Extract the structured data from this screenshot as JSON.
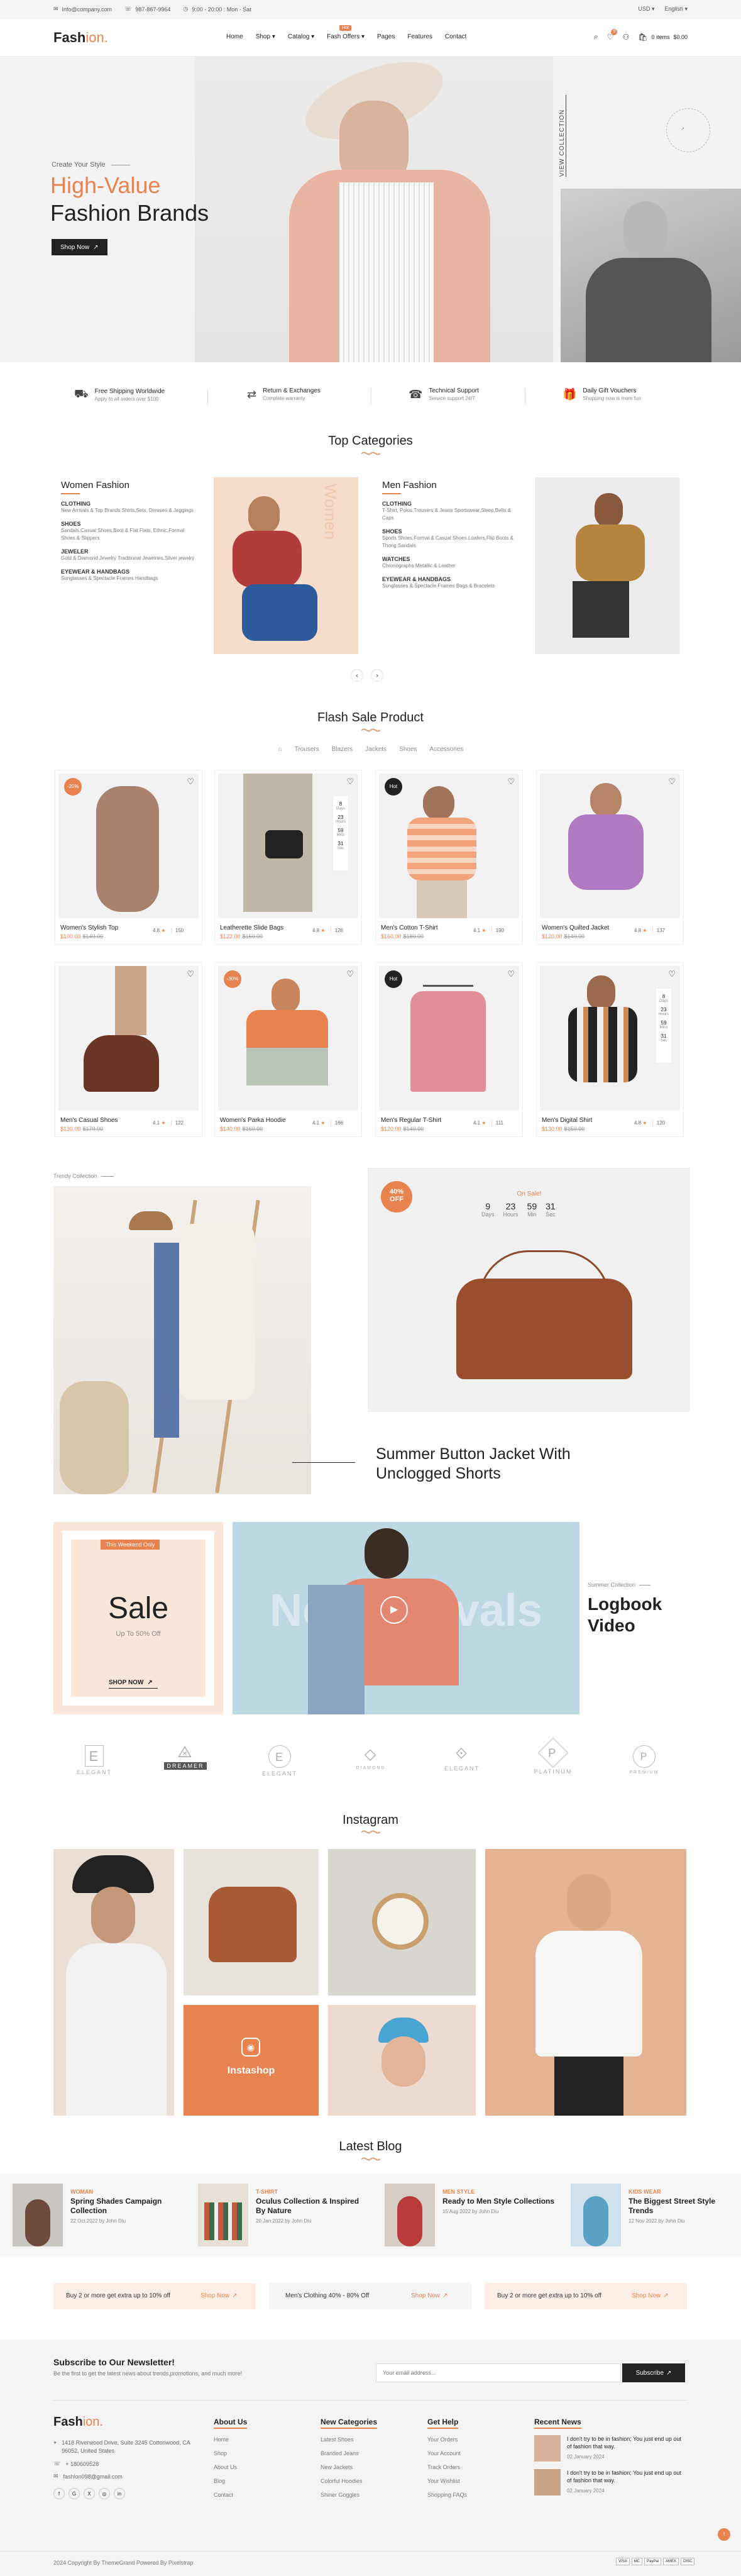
{
  "topbar": {
    "email": "Info@company.com",
    "phone": "987-867-9964",
    "hours": "9:00 - 20:00 : Mon - Sat",
    "currency": "USD",
    "language": "English"
  },
  "nav": {
    "logo_a": "Fash",
    "logo_b": "ion.",
    "menu": [
      "Home",
      "Shop",
      "Catalog",
      "Fash Offers",
      "Pages",
      "Features",
      "Contact"
    ],
    "hot_badge": "Hot",
    "cart_count": "0",
    "cart_label": "0 items",
    "cart_total": "$0.00",
    "wish_count": "0"
  },
  "hero": {
    "kicker": "Create Your Style",
    "title_a": "High-Value",
    "title_b": "Fashion Brands",
    "cta": "Shop Now",
    "side_link": "VIEW COLLECTION",
    "circle_text": "LUXURY · BEST SELLER · LUXURY ·"
  },
  "features": [
    {
      "title": "Free Shipping Worldwide",
      "sub": "Apply to all orders over $100"
    },
    {
      "title": "Return & Exchanges",
      "sub": "Complete warranty"
    },
    {
      "title": "Technical Support",
      "sub": "Service support 24/7"
    },
    {
      "title": "Daily Gift Vouchers",
      "sub": "Shopping now is more fun"
    }
  ],
  "categories": {
    "title": "Top Categories",
    "women": {
      "title": "Women Fashion",
      "groups": [
        {
          "h": "CLOTHING",
          "t": "New Arrivals & Top Brands Shirts,Sets, Dresses & Jeggings"
        },
        {
          "h": "SHOES",
          "t": "Sandals,Casual Shoes,Boot & Flat Flats, Ethnic,Formal Shoes & Slippers"
        },
        {
          "h": "JEWELER",
          "t": "Gold & Diamond Jewelry Traditional Jewelries,Silver jewelry"
        },
        {
          "h": "EYEWEAR & HANDBAGS",
          "t": "Sunglasses & Spectacle Frames Handbags"
        }
      ],
      "banner": "Women"
    },
    "men": {
      "title": "Men Fashion",
      "groups": [
        {
          "h": "CLOTHING",
          "t": "T-Shirt, Polos,Trousers & Jeans Sportswear,Sleep,Belts & Caps"
        },
        {
          "h": "SHOES",
          "t": "Sports Shoes,Formal & Casual Shoes Loafers,Flip Boots & Thong Sandals"
        },
        {
          "h": "WATCHES",
          "t": "Chronographs Metallic & Leather"
        },
        {
          "h": "EYEWEAR & HANDBAGS",
          "t": "Sunglasses & Spectacle Frames Bags & Bracelets"
        }
      ]
    }
  },
  "flash": {
    "title": "Flash Sale Product",
    "tabs": [
      "All",
      "Trousers",
      "Blazers",
      "Jackets",
      "Shoes",
      "Accessories"
    ],
    "products": [
      {
        "name": "Women's Stylish Top",
        "price": "$100.00",
        "old": "$140.00",
        "rating": "4.8",
        "reviews": "150",
        "badge": "-20%"
      },
      {
        "name": "Leatherette Slide Bags",
        "price": "$122.00",
        "old": "$150.00",
        "rating": "4.8",
        "reviews": "126",
        "badge": ""
      },
      {
        "name": "Men's Cotton T-Shirt",
        "price": "$160.00",
        "old": "$180.00",
        "rating": "4.1",
        "reviews": "190",
        "badge": "Hot"
      },
      {
        "name": "Women's Quilted Jacket",
        "price": "$120.00",
        "old": "$140.00",
        "rating": "4.8",
        "reviews": "137",
        "badge": ""
      },
      {
        "name": "Men's Casual Shoes",
        "price": "$130.00",
        "old": "$170.00",
        "rating": "4.1",
        "reviews": "122",
        "badge": ""
      },
      {
        "name": "Women's Parka Hoodie",
        "price": "$140.00",
        "old": "$160.00",
        "rating": "4.1",
        "reviews": "166",
        "badge": "-30%"
      },
      {
        "name": "Men's Regular T-Shirt",
        "price": "$120.00",
        "old": "$140.00",
        "rating": "4.1",
        "reviews": "111",
        "badge": "Hot"
      },
      {
        "name": "Men's Digital Shirt",
        "price": "$130.00",
        "old": "$150.00",
        "rating": "4.8",
        "reviews": "120",
        "badge": ""
      }
    ],
    "countdown_a": {
      "d": "8",
      "dl": "Days",
      "h": "23",
      "hl": "Hours",
      "m": "59",
      "ml": "Mins",
      "s": "31",
      "sl": "Sec"
    }
  },
  "trendy": {
    "label": "Trendy Collection",
    "heading": "Summer Button Jacket With Unclogged Shorts",
    "sale_badge_a": "40%",
    "sale_badge_b": "OFF",
    "on_sale": "On Sale!",
    "cd": [
      {
        "v": "9",
        "l": "Days"
      },
      {
        "v": "23",
        "l": "Hours"
      },
      {
        "v": "59",
        "l": "Min"
      },
      {
        "v": "31",
        "l": "Sec"
      }
    ]
  },
  "sale": {
    "tag": "This Weekend Only",
    "title": "Sale",
    "sub": "Up To 50% Off",
    "cta": "SHOP NOW",
    "video_text": "New Arrivals",
    "video_kicker": "Summer Collection",
    "video_title_a": "Logbook",
    "video_title_b": "Video"
  },
  "brands": [
    "ELEGANT",
    "DREAMER",
    "ELEGANT",
    "DIAMOND",
    "ELEGANT",
    "PLATINUM",
    "PREMIUM"
  ],
  "instagram": {
    "title": "Instagram",
    "cta": "Instashop"
  },
  "blog": {
    "title": "Latest Blog",
    "posts": [
      {
        "cat": "WOMAN",
        "title": "Spring Shades Campaign Collection",
        "meta": "22 Oct 2022 by John Diu"
      },
      {
        "cat": "T-SHIRT",
        "title": "Oculus Collection & Inspired By Nature",
        "meta": "20 Jan 2022 by John Diu"
      },
      {
        "cat": "MEN STYLE",
        "title": "Ready to Men Style Collections",
        "meta": "15 Aug 2022 by John Diu"
      },
      {
        "cat": "KIDS WEAR",
        "title": "The Biggest Street Style Trends",
        "meta": "12 Nov 2022 by John Diu"
      }
    ]
  },
  "promos": [
    {
      "text": "Buy 2 or more get extra up to 10% off",
      "cta": "Shop Now"
    },
    {
      "text": "Men's Clothing 40% - 80% Off",
      "cta": "Shop Now"
    },
    {
      "text": "Buy 2 or more get extra up to 10% off",
      "cta": "Shop Now"
    }
  ],
  "newsletter": {
    "title": "Subscribe to Our Newsletter!",
    "sub": "Be the first to get the latest news about trends,promotions, and much more!",
    "placeholder": "Your email address...",
    "cta": "Subscribe"
  },
  "footer": {
    "logo_a": "Fash",
    "logo_b": "ion.",
    "address": "1418 Riverwood Drive, Suite 3245 Cottonwood, CA 96052, United States",
    "phone": "+ 180609528",
    "email": "fashion098@gmail.com",
    "cols": [
      {
        "h": "About Us",
        "items": [
          "Home",
          "Shop",
          "About Us",
          "Blog",
          "Contact"
        ]
      },
      {
        "h": "New Categories",
        "items": [
          "Latest Shoes",
          "Branded Jeans",
          "New Jackets",
          "Colorful Hoodies",
          "Shiner Goggles"
        ]
      },
      {
        "h": "Get Help",
        "items": [
          "Your Orders",
          "Your Account",
          "Track Orders",
          "Your Wishlist",
          "Shopping FAQs"
        ]
      }
    ],
    "news_h": "Recent News",
    "news": [
      {
        "t": "I don't try to be in fashion; You just end up out of fashion that way.",
        "d": "02 January 2024"
      },
      {
        "t": "I don't try to be in fashion; You just end up out of fashion that way.",
        "d": "02 January 2024"
      }
    ],
    "copyright": "2024 Copyright By ThemeGrand Powered By Pixelstrap",
    "payments": [
      "VISA",
      "MC",
      "PayPal",
      "AMEX",
      "DISC"
    ]
  },
  "colors": {
    "accent": "#e8834f",
    "dark": "#222222"
  }
}
